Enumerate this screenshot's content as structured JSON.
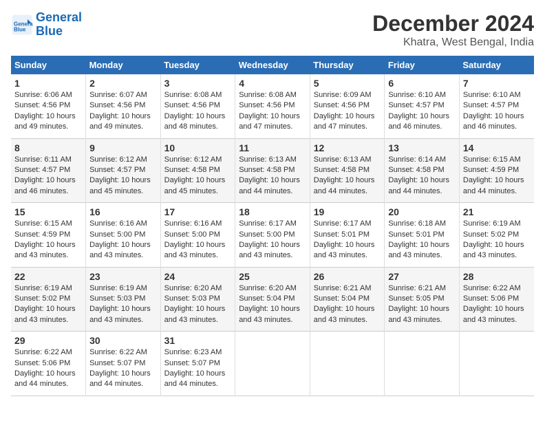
{
  "logo": {
    "text_general": "General",
    "text_blue": "Blue"
  },
  "title": "December 2024",
  "subtitle": "Khatra, West Bengal, India",
  "header_days": [
    "Sunday",
    "Monday",
    "Tuesday",
    "Wednesday",
    "Thursday",
    "Friday",
    "Saturday"
  ],
  "weeks": [
    [
      {
        "day": "1",
        "sunrise": "6:06 AM",
        "sunset": "4:56 PM",
        "daylight": "10 hours and 49 minutes."
      },
      {
        "day": "2",
        "sunrise": "6:07 AM",
        "sunset": "4:56 PM",
        "daylight": "10 hours and 49 minutes."
      },
      {
        "day": "3",
        "sunrise": "6:08 AM",
        "sunset": "4:56 PM",
        "daylight": "10 hours and 48 minutes."
      },
      {
        "day": "4",
        "sunrise": "6:08 AM",
        "sunset": "4:56 PM",
        "daylight": "10 hours and 47 minutes."
      },
      {
        "day": "5",
        "sunrise": "6:09 AM",
        "sunset": "4:56 PM",
        "daylight": "10 hours and 47 minutes."
      },
      {
        "day": "6",
        "sunrise": "6:10 AM",
        "sunset": "4:57 PM",
        "daylight": "10 hours and 46 minutes."
      },
      {
        "day": "7",
        "sunrise": "6:10 AM",
        "sunset": "4:57 PM",
        "daylight": "10 hours and 46 minutes."
      }
    ],
    [
      {
        "day": "8",
        "sunrise": "6:11 AM",
        "sunset": "4:57 PM",
        "daylight": "10 hours and 46 minutes."
      },
      {
        "day": "9",
        "sunrise": "6:12 AM",
        "sunset": "4:57 PM",
        "daylight": "10 hours and 45 minutes."
      },
      {
        "day": "10",
        "sunrise": "6:12 AM",
        "sunset": "4:58 PM",
        "daylight": "10 hours and 45 minutes."
      },
      {
        "day": "11",
        "sunrise": "6:13 AM",
        "sunset": "4:58 PM",
        "daylight": "10 hours and 44 minutes."
      },
      {
        "day": "12",
        "sunrise": "6:13 AM",
        "sunset": "4:58 PM",
        "daylight": "10 hours and 44 minutes."
      },
      {
        "day": "13",
        "sunrise": "6:14 AM",
        "sunset": "4:58 PM",
        "daylight": "10 hours and 44 minutes."
      },
      {
        "day": "14",
        "sunrise": "6:15 AM",
        "sunset": "4:59 PM",
        "daylight": "10 hours and 44 minutes."
      }
    ],
    [
      {
        "day": "15",
        "sunrise": "6:15 AM",
        "sunset": "4:59 PM",
        "daylight": "10 hours and 43 minutes."
      },
      {
        "day": "16",
        "sunrise": "6:16 AM",
        "sunset": "5:00 PM",
        "daylight": "10 hours and 43 minutes."
      },
      {
        "day": "17",
        "sunrise": "6:16 AM",
        "sunset": "5:00 PM",
        "daylight": "10 hours and 43 minutes."
      },
      {
        "day": "18",
        "sunrise": "6:17 AM",
        "sunset": "5:00 PM",
        "daylight": "10 hours and 43 minutes."
      },
      {
        "day": "19",
        "sunrise": "6:17 AM",
        "sunset": "5:01 PM",
        "daylight": "10 hours and 43 minutes."
      },
      {
        "day": "20",
        "sunrise": "6:18 AM",
        "sunset": "5:01 PM",
        "daylight": "10 hours and 43 minutes."
      },
      {
        "day": "21",
        "sunrise": "6:19 AM",
        "sunset": "5:02 PM",
        "daylight": "10 hours and 43 minutes."
      }
    ],
    [
      {
        "day": "22",
        "sunrise": "6:19 AM",
        "sunset": "5:02 PM",
        "daylight": "10 hours and 43 minutes."
      },
      {
        "day": "23",
        "sunrise": "6:19 AM",
        "sunset": "5:03 PM",
        "daylight": "10 hours and 43 minutes."
      },
      {
        "day": "24",
        "sunrise": "6:20 AM",
        "sunset": "5:03 PM",
        "daylight": "10 hours and 43 minutes."
      },
      {
        "day": "25",
        "sunrise": "6:20 AM",
        "sunset": "5:04 PM",
        "daylight": "10 hours and 43 minutes."
      },
      {
        "day": "26",
        "sunrise": "6:21 AM",
        "sunset": "5:04 PM",
        "daylight": "10 hours and 43 minutes."
      },
      {
        "day": "27",
        "sunrise": "6:21 AM",
        "sunset": "5:05 PM",
        "daylight": "10 hours and 43 minutes."
      },
      {
        "day": "28",
        "sunrise": "6:22 AM",
        "sunset": "5:06 PM",
        "daylight": "10 hours and 43 minutes."
      }
    ],
    [
      {
        "day": "29",
        "sunrise": "6:22 AM",
        "sunset": "5:06 PM",
        "daylight": "10 hours and 44 minutes."
      },
      {
        "day": "30",
        "sunrise": "6:22 AM",
        "sunset": "5:07 PM",
        "daylight": "10 hours and 44 minutes."
      },
      {
        "day": "31",
        "sunrise": "6:23 AM",
        "sunset": "5:07 PM",
        "daylight": "10 hours and 44 minutes."
      },
      null,
      null,
      null,
      null
    ]
  ]
}
